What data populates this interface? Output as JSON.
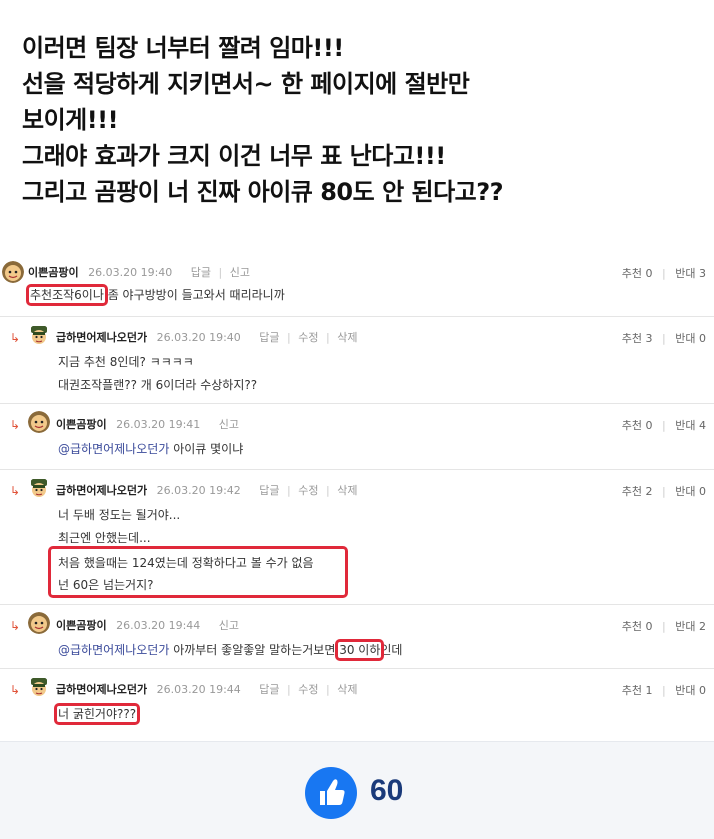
{
  "headline": {
    "lines": [
      "이러면 팀장 너부터 짤려 임마!!!",
      "선을 적당하게 지키면서~ 한 페이지에 절반만",
      "보이게!!!",
      "그래야 효과가 크지 이건 너무 표 난다고!!!",
      "그리고 곰팡이 너 진짜 아이큐 80도 안 된다고??"
    ]
  },
  "comments": [
    {
      "nickname": "이쁜곰팡이",
      "datetime": "26.03.20 19:40",
      "actions": [
        "답글",
        "신고"
      ],
      "upvote": "추천 0",
      "downvote": "반대 3",
      "body": {
        "highlight": "추천조작6이나",
        "rest": " 좀 야구방방이 들고와서 때리라니까"
      }
    },
    {
      "nickname": "급하면어제나오던가",
      "datetime": "26.03.20 19:40",
      "actions": [
        "답글",
        "수정",
        "삭제"
      ],
      "upvote": "추천 3",
      "downvote": "반대 0",
      "lines": [
        "지금 추천 8인데? ㅋㅋㅋㅋ",
        "대권조작플랜?? 개 6이더라 수상하지??"
      ]
    },
    {
      "nickname": "이쁜곰팡이",
      "datetime": "26.03.20 19:41",
      "actions": [
        "신고"
      ],
      "upvote": "추천 0",
      "downvote": "반대 4",
      "mention": "@급하면어제나오던가",
      "rest": " 아이큐 몇이냐"
    },
    {
      "nickname": "급하면어제나오던가",
      "datetime": "26.03.20 19:42",
      "actions": [
        "답글",
        "수정",
        "삭제"
      ],
      "upvote": "추천 2",
      "downvote": "반대 0",
      "lines": [
        "너 두배 정도는 될거야...",
        "최근엔 안했는데..."
      ],
      "highlight_lines": [
        "처음 했을때는 124였는데 정확하다고 볼 수가 없음",
        "넌 60은 넘는거지?"
      ]
    },
    {
      "nickname": "이쁜곰팡이",
      "datetime": "26.03.20 19:44",
      "actions": [
        "신고"
      ],
      "upvote": "추천 0",
      "downvote": "반대 2",
      "mention": "@급하면어제나오던가",
      "rest_before": " 아까부터 좋알좋알 말하는거보면 ",
      "highlight": "30 이하",
      "rest_after": "인데"
    },
    {
      "nickname": "급하면어제나오던가",
      "datetime": "26.03.20 19:44",
      "actions": [
        "답글",
        "수정",
        "삭제"
      ],
      "upvote": "추천 1",
      "downvote": "반대 0",
      "highlight": "너 굵힌거야???"
    }
  ],
  "footer": {
    "like_icon": "thumbs-up-icon",
    "like_count": "60"
  },
  "colors": {
    "highlight_box": "#e0293a",
    "like_blue": "#1877f2",
    "count_color": "#1a3a7a"
  }
}
